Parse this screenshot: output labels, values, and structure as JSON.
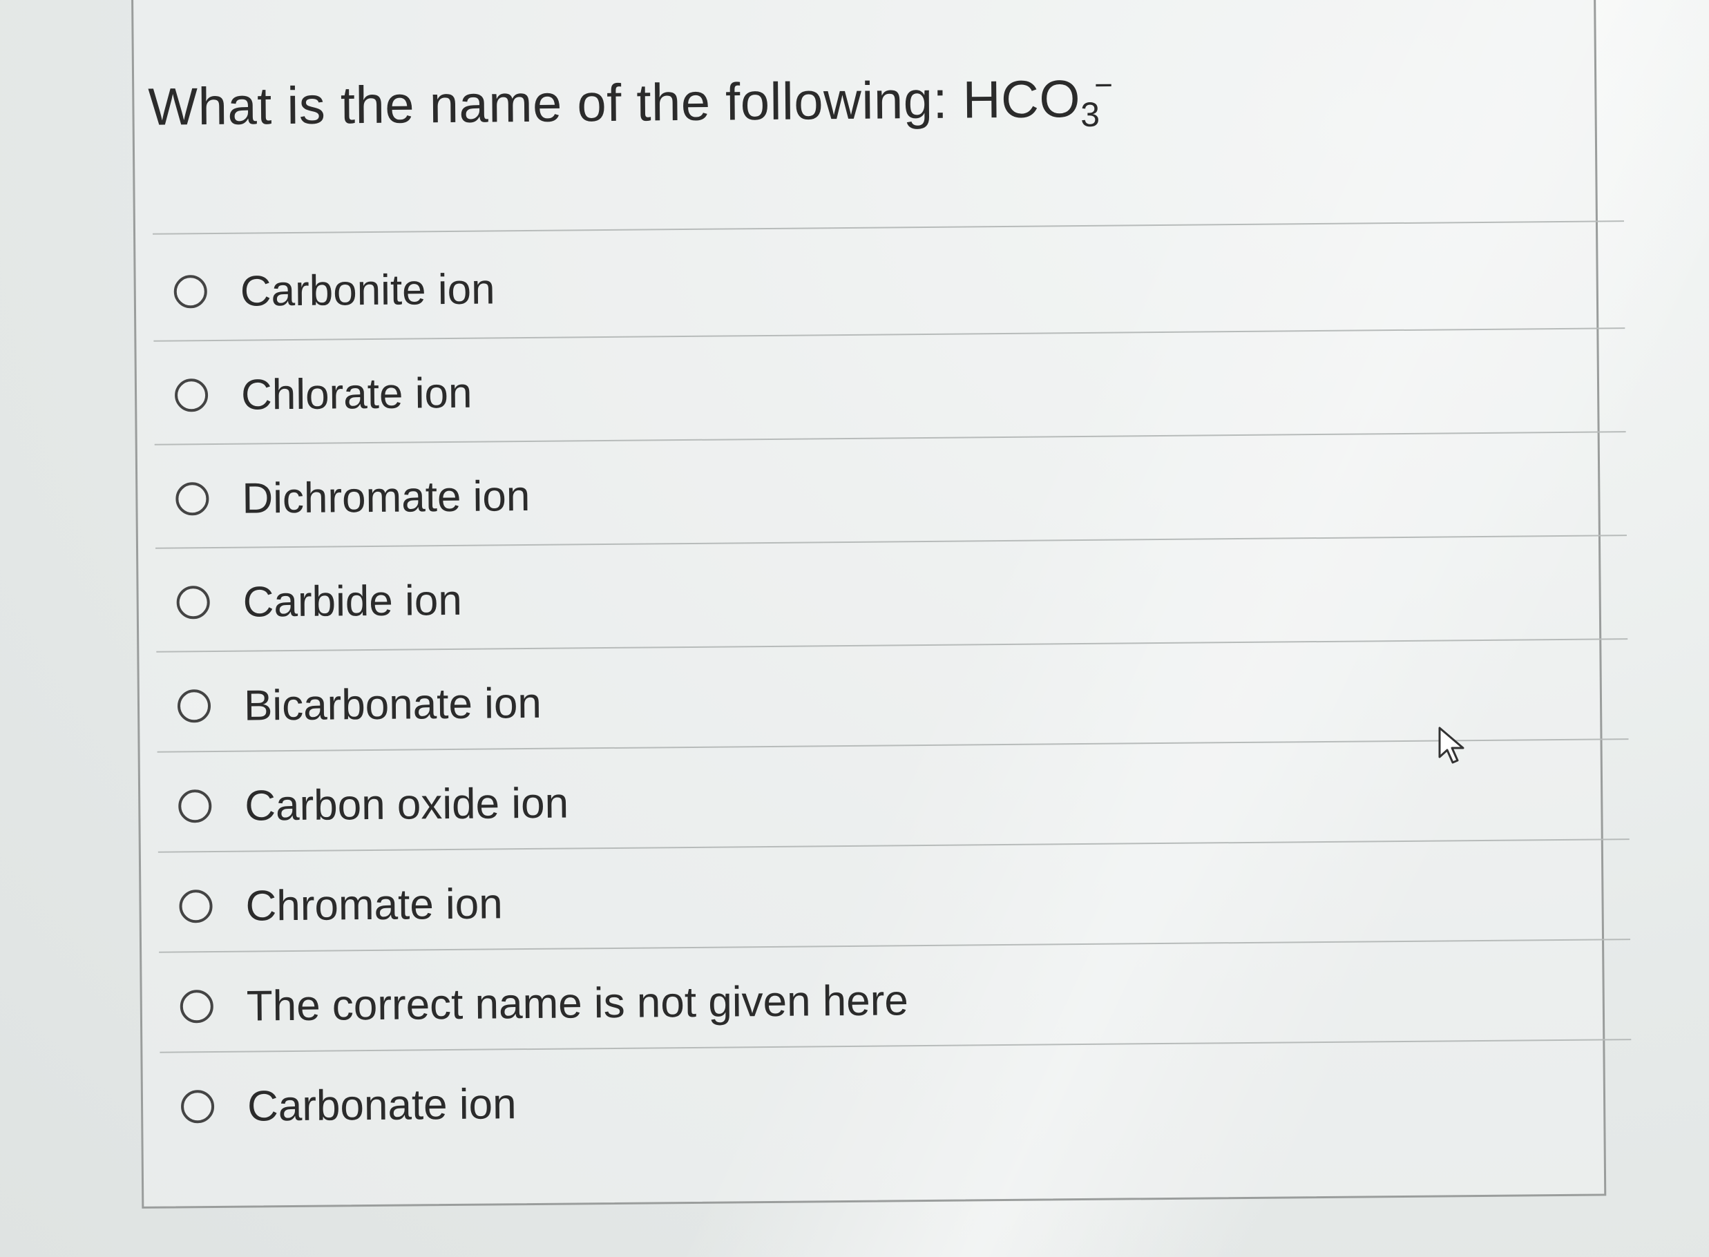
{
  "question": {
    "prefix": "What is the name of the following: ",
    "formula_base": "HCO",
    "formula_subscript": "3",
    "formula_charge": "−"
  },
  "options": [
    {
      "label": "Carbonite ion",
      "selected": false
    },
    {
      "label": "Chlorate ion",
      "selected": false
    },
    {
      "label": "Dichromate ion",
      "selected": false
    },
    {
      "label": "Carbide ion",
      "selected": false
    },
    {
      "label": "Bicarbonate ion",
      "selected": false
    },
    {
      "label": "Carbon oxide ion",
      "selected": false
    },
    {
      "label": "Chromate ion",
      "selected": false
    },
    {
      "label": "The correct name is not given here",
      "selected": false
    },
    {
      "label": "Carbonate ion",
      "selected": false
    }
  ],
  "icons": {
    "radio": "radio-unchecked-icon",
    "cursor": "mouse-pointer-icon"
  },
  "colors": {
    "text": "#2b2b2b",
    "border": "#9a9d9c",
    "divider": "#b7bbba"
  }
}
